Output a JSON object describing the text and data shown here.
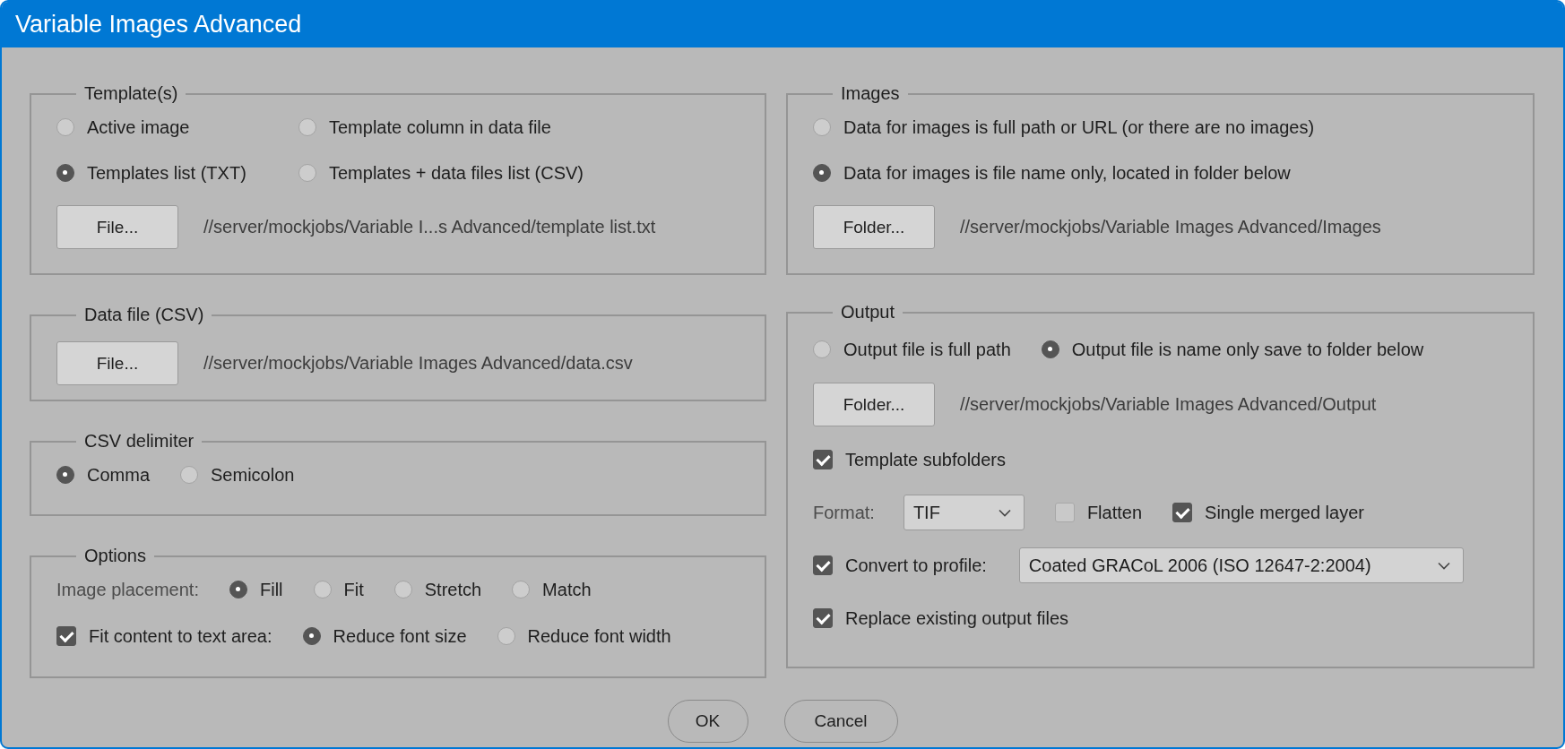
{
  "window": {
    "title": "Variable Images Advanced"
  },
  "left_column": {
    "groups": [
      {
        "title": "Template(s)",
        "rows": [
          {
            "items": [
              {
                "kind": "radio",
                "label": "Active image",
                "selected": false
              },
              {
                "kind": "radio",
                "label": "Template column in data file",
                "selected": false
              }
            ]
          },
          {
            "items": [
              {
                "kind": "radio",
                "label": "Templates list (TXT)",
                "selected": true
              },
              {
                "kind": "radio",
                "label": "Templates + data files list (CSV)",
                "selected": false
              }
            ]
          },
          {
            "items": [
              {
                "kind": "button",
                "label": "File..."
              },
              {
                "kind": "path",
                "text": "//server/mockjobs/Variable I...s Advanced/template list.txt"
              }
            ]
          }
        ]
      },
      {
        "title": "Data file (CSV)",
        "rows": [
          {
            "items": [
              {
                "kind": "button",
                "label": "File..."
              },
              {
                "kind": "path",
                "text": "//server/mockjobs/Variable Images Advanced/data.csv"
              }
            ]
          }
        ]
      },
      {
        "title": "CSV delimiter",
        "rows": [
          {
            "items": [
              {
                "kind": "radio",
                "label": "Comma",
                "selected": true
              },
              {
                "kind": "radio",
                "label": "Semicolon",
                "selected": false
              }
            ]
          }
        ]
      },
      {
        "title": "Options",
        "rows": [
          {
            "items": [
              {
                "kind": "label",
                "text": "Image placement:"
              },
              {
                "kind": "radio",
                "label": "Fill",
                "selected": true
              },
              {
                "kind": "radio",
                "label": "Fit",
                "selected": false
              },
              {
                "kind": "radio",
                "label": "Stretch",
                "selected": false
              },
              {
                "kind": "radio",
                "label": "Match",
                "selected": false
              }
            ]
          },
          {
            "items": [
              {
                "kind": "checkbox",
                "label": "Fit content to text area:",
                "checked": true
              },
              {
                "kind": "radio",
                "label": "Reduce font size",
                "selected": true
              },
              {
                "kind": "radio",
                "label": "Reduce font width",
                "selected": false
              }
            ]
          }
        ]
      }
    ]
  },
  "right_column": {
    "groups": [
      {
        "title": "Images",
        "rows": [
          {
            "items": [
              {
                "kind": "radio",
                "label": "Data for images is full path or URL (or there are no images)",
                "selected": false
              }
            ]
          },
          {
            "items": [
              {
                "kind": "radio",
                "label": "Data for images is file name only, located in folder below",
                "selected": true
              }
            ]
          },
          {
            "items": [
              {
                "kind": "button",
                "label": "Folder..."
              },
              {
                "kind": "path",
                "text": "//server/mockjobs/Variable Images Advanced/Images"
              }
            ]
          }
        ]
      },
      {
        "title": "Output",
        "rows": [
          {
            "items": [
              {
                "kind": "radio",
                "label": "Output file is full path",
                "selected": false
              },
              {
                "kind": "radio",
                "label": "Output file is name only save to folder below",
                "selected": true
              }
            ]
          },
          {
            "items": [
              {
                "kind": "button",
                "label": "Folder..."
              },
              {
                "kind": "path",
                "text": "//server/mockjobs/Variable Images Advanced/Output"
              }
            ]
          },
          {
            "items": [
              {
                "kind": "checkbox",
                "label": "Template subfolders",
                "checked": true
              }
            ]
          },
          {
            "items": [
              {
                "kind": "label",
                "text": "Format:"
              },
              {
                "kind": "select",
                "value": "TIF"
              },
              {
                "kind": "checkbox",
                "label": "Flatten",
                "checked": false
              },
              {
                "kind": "checkbox",
                "label": "Single merged layer",
                "checked": true
              }
            ]
          },
          {
            "items": [
              {
                "kind": "checkbox",
                "label": "Convert to profile:",
                "checked": true
              },
              {
                "kind": "select",
                "value": "Coated GRACoL 2006 (ISO 12647-2:2004)"
              }
            ]
          },
          {
            "items": [
              {
                "kind": "checkbox",
                "label": "Replace existing output files",
                "checked": true
              }
            ]
          }
        ]
      }
    ]
  },
  "buttons": [
    {
      "label": "OK"
    },
    {
      "label": "Cancel"
    }
  ]
}
